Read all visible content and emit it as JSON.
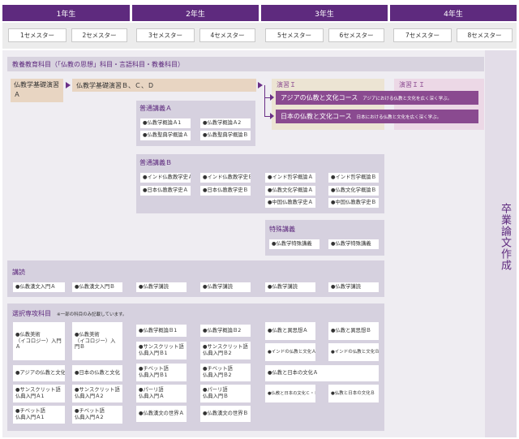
{
  "years": [
    "1年生",
    "2年生",
    "3年生",
    "4年生"
  ],
  "semesters": [
    "1セメスター",
    "2セメスター",
    "3セメスター",
    "4セメスター",
    "5セメスター",
    "6セメスター",
    "7セメスター",
    "8セメスター"
  ],
  "liberal_arts": "教養教育科目（「仏教の思想」科目・言語科目・教養科目）",
  "basic_seminar_a": "仏教学基礎演習Ａ",
  "basic_seminar_bcd": "仏教学基礎演習Ｂ、Ｃ、Ｄ",
  "seminar1": "演習Ｉ",
  "seminar2": "演習ＩＩ",
  "course_asia": {
    "name": "アジアの仏教と文化コース",
    "desc": "アジアにおける仏教と文化を広く深く学ぶ。"
  },
  "course_japan": {
    "name": "日本の仏教と文化コース",
    "desc": "日本における仏教と文化を広く深く学ぶ。"
  },
  "thesis": "卒業論文作成",
  "general_a": {
    "title": "普通講義Ａ",
    "items": [
      "●仏教学概論Ａ1",
      "●仏教学概論Ａ2",
      "●仏教聖典学概論Ａ",
      "●仏教聖典学概論Ｂ"
    ]
  },
  "general_b": {
    "title": "普通講義Ｂ",
    "items": [
      "●インド仏教教学史Ａ",
      "●インド仏教教学史Ｂ",
      "●インド哲学概論Ａ",
      "●インド哲学概論Ｂ",
      "●日本仏教教学史Ａ",
      "●日本仏教教学史Ｂ",
      "●仏教文化学概論Ａ",
      "●仏教文化学概論Ｂ",
      "●中国仏教教学史Ａ",
      "●中国仏教教学史Ｂ"
    ]
  },
  "special": {
    "title": "特殊講義",
    "items": [
      "●仏教学特殊講義",
      "●仏教学特殊講義"
    ]
  },
  "reading": {
    "title": "講読",
    "items": [
      "●仏教漢文入門Ａ",
      "●仏教漢文入門Ｂ",
      "●仏教学講読",
      "●仏教学講読",
      "●仏教学講読",
      "●仏教学講読"
    ]
  },
  "elective": {
    "title": "選択専攻科目",
    "note": "※一部の科目のみ記載しています。",
    "items": [
      "●仏教美術\n（イコロジー）入門Ａ",
      "●仏教美術\n（イコロジー）入門Ｂ",
      "●アジアの仏教と文化",
      "●日本の仏教と文化",
      "●サンスクリット語\n仏典入門Ａ1",
      "●サンスクリット語\n仏典入門Ａ2",
      "●チベット語\n仏典入門Ａ1",
      "●チベット語\n仏典入門Ａ2",
      "●仏教学概論Ｂ1",
      "●仏教学概論Ｂ2",
      "●サンスクリット語\n仏典入門Ｂ1",
      "●サンスクリット語\n仏典入門Ｂ2",
      "●チベット語\n仏典入門Ｂ1",
      "●チベット語\n仏典入門Ｂ2",
      "●パーリ語\n仏典入門Ａ",
      "●パーリ語\n仏典入門Ｂ",
      "●仏教漢文の世界Ａ",
      "●仏教漢文の世界Ｂ",
      "●仏教と異思想Ａ",
      "●仏教と異思想Ｂ",
      "●インドの仏教と文化Ａ",
      "●インドの仏教と文化Ｂ",
      "●仏教と日本の文化Ａ",
      "●仏教と日本の文化Ｃ・Ｄ",
      "●仏教と日本の文化Ｂ"
    ]
  },
  "colors": {
    "year_header": "#5e2a7e",
    "accent_magenta": "#8a4a90",
    "basic_tan": "#e8d5c2",
    "panel": "#e6e3ec"
  }
}
